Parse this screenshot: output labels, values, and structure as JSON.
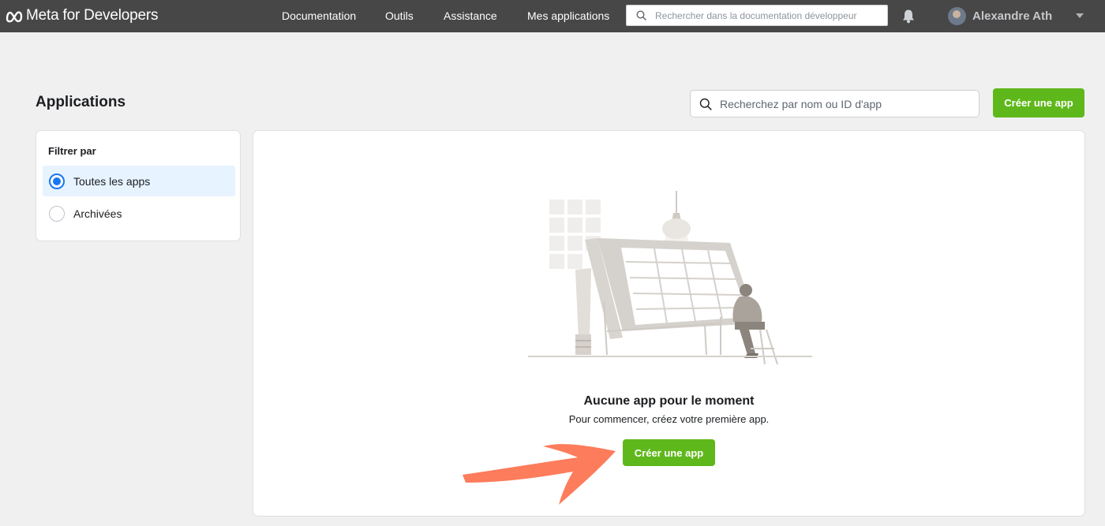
{
  "topbar": {
    "brand": "Meta for Developers",
    "nav": [
      "Documentation",
      "Outils",
      "Assistance",
      "Mes applications"
    ],
    "search_placeholder": "Rechercher dans la documentation développeur",
    "user_name": "Alexandre Ath"
  },
  "page": {
    "title": "Applications",
    "search_placeholder": "Recherchez par nom ou ID d'app",
    "create_button": "Créer une app"
  },
  "filter": {
    "title": "Filtrer par",
    "options": [
      {
        "label": "Toutes les apps",
        "selected": true
      },
      {
        "label": "Archivées",
        "selected": false
      }
    ]
  },
  "empty_state": {
    "title": "Aucune app pour le moment",
    "subtitle": "Pour commencer, créez votre première app.",
    "button": "Créer une app"
  },
  "colors": {
    "topbar": "#474747",
    "accent_green": "#5fb81b",
    "radio_blue": "#1877f2",
    "annotation_arrow": "#fd7c5b"
  }
}
